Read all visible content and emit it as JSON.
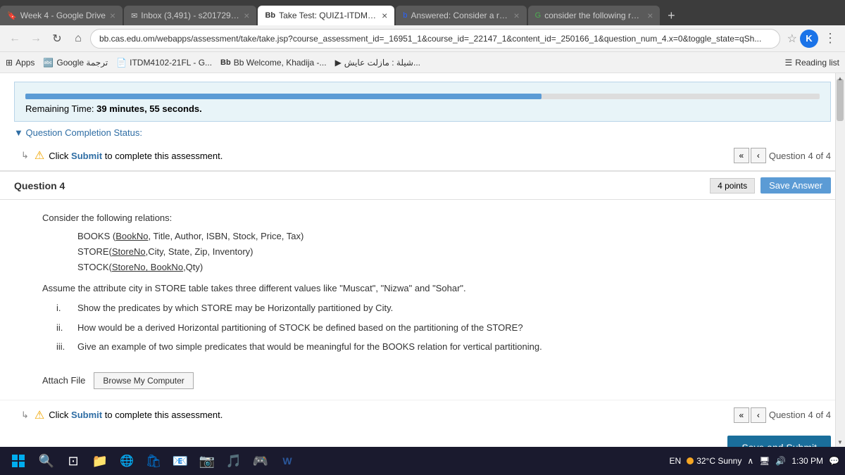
{
  "tabs": [
    {
      "id": "tab1",
      "icon": "🔖",
      "label": "Week 4 - Google Drive",
      "active": false
    },
    {
      "id": "tab2",
      "icon": "✉",
      "label": "Inbox (3,491) - s2017293042...",
      "active": false
    },
    {
      "id": "tab3",
      "icon": "Bb",
      "label": "Take Test: QUIZ1-ITDM4102-...",
      "active": true
    },
    {
      "id": "tab4",
      "icon": "b",
      "label": "Answered: Consider a relatio...",
      "active": false
    },
    {
      "id": "tab5",
      "icon": "G",
      "label": "consider the following relati...",
      "active": false
    }
  ],
  "address_bar": {
    "url": "bb.cas.edu.om/webapps/assessment/take/take.jsp?course_assessment_id=_16951_1&course_id=_22147_1&content_id=_250166_1&question_num_4.x=0&toggle_state=qSh..."
  },
  "bookmarks": [
    {
      "label": "Apps"
    },
    {
      "label": "Google ترجمة"
    },
    {
      "label": "ITDM4102-21FL - G..."
    },
    {
      "label": "Bb Welcome, Khadija -..."
    },
    {
      "label": "شيلة : مازلت عايش..."
    }
  ],
  "reading_list": "Reading list",
  "timer": {
    "label": "Remaining Time:",
    "value": "39 minutes, 55 seconds.",
    "progress_percent": 65
  },
  "question_completion": "Question Completion Status:",
  "alert1": {
    "text": "Click",
    "link": "Submit",
    "suffix": " to complete this assessment."
  },
  "nav_label": "Question 4 of 4",
  "question": {
    "title": "Question 4",
    "points": "4 points",
    "save_answer": "Save Answer",
    "intro": "Consider the following relations:",
    "relations": [
      "BOOKS (BookNo, Title, Author, ISBN, Stock, Price, Tax)",
      "STORE(StoreNo,City, State, Zip, Inventory)",
      "STOCK(StoreNo, BookNo,Qty)"
    ],
    "assume_text": "Assume the attribute city in STORE table takes three different values like \"Muscat\", \"Nizwa\" and \"Sohar\".",
    "sub_questions": [
      {
        "num": "i.",
        "text": "Show the predicates by which STORE may be Horizontally partitioned by City."
      },
      {
        "num": "ii.",
        "text": "How would be a derived Horizontal partitioning of STOCK be defined based on the partitioning of the STORE?"
      },
      {
        "num": "iii.",
        "text": "Give an example of two simple predicates that would be meaningful for the BOOKS relation for vertical partitioning."
      }
    ]
  },
  "attach": {
    "label": "Attach File",
    "button": "Browse My Computer"
  },
  "alert2": {
    "text": "Click",
    "link": "Submit",
    "suffix": " to complete this assessment."
  },
  "nav_label2": "Question 4 of 4",
  "save_submit": "Save and Submit",
  "taskbar": {
    "lang": "EN",
    "temp": "32°C Sunny",
    "time": "1:30 PM"
  }
}
